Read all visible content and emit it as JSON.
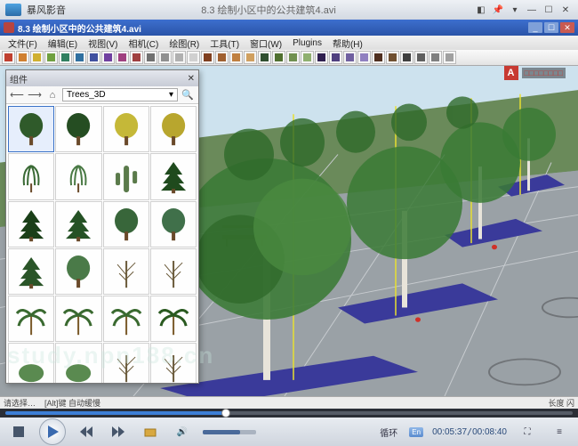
{
  "player": {
    "title": "暴风影音",
    "seek_percent": 38,
    "time_current": "00:05:37",
    "time_total": "00:08:40",
    "lang_badge": "En",
    "loop_label": "循环"
  },
  "app": {
    "title": "8.3 绘制小区中的公共建筑4.avi",
    "menu": {
      "file": "文件(F)",
      "edit": "编辑(E)",
      "view": "视图(V)",
      "camera": "相机(C)",
      "draw": "绘图(R)",
      "tools": "工具(T)",
      "window": "窗口(W)",
      "plugins": "Plugins",
      "help": "帮助(H)"
    },
    "status": {
      "left": "请选择…",
      "hint": "[Alt]键  自动缓慢",
      "right": "长度 闪"
    }
  },
  "panel": {
    "title": "组件",
    "collection": "Trees_3D"
  },
  "watermark": {
    "badge": "A",
    "text": "study.npn188.cn"
  },
  "thumbs": [
    {
      "shape": "broad",
      "fill": "#2f5a2a"
    },
    {
      "shape": "broad",
      "fill": "#254d22"
    },
    {
      "shape": "broad",
      "fill": "#c5b838"
    },
    {
      "shape": "broad",
      "fill": "#b8a62e"
    },
    {
      "shape": "weep",
      "fill": "#3a6a35"
    },
    {
      "shape": "weep",
      "fill": "#4a7a45"
    },
    {
      "shape": "cactus",
      "fill": "#5a7a4a"
    },
    {
      "shape": "pine",
      "fill": "#1f4a1d"
    },
    {
      "shape": "pine",
      "fill": "#1a3f18"
    },
    {
      "shape": "pine",
      "fill": "#255225"
    },
    {
      "shape": "broad",
      "fill": "#38663a"
    },
    {
      "shape": "broad",
      "fill": "#40704a"
    },
    {
      "shape": "pine",
      "fill": "#2a5528"
    },
    {
      "shape": "broad",
      "fill": "#4a7a48"
    },
    {
      "shape": "bare",
      "fill": "#6a5a3a"
    },
    {
      "shape": "bare",
      "fill": "#6a5a3a"
    },
    {
      "shape": "palm",
      "fill": "#3a6a30"
    },
    {
      "shape": "palm",
      "fill": "#3a6a30"
    },
    {
      "shape": "palm",
      "fill": "#3a6a30"
    },
    {
      "shape": "palm",
      "fill": "#2a5a20"
    },
    {
      "shape": "shrub",
      "fill": "#5a8a50"
    },
    {
      "shape": "shrub",
      "fill": "#5a8a50"
    },
    {
      "shape": "bare",
      "fill": "#6a5a3a"
    },
    {
      "shape": "bare",
      "fill": "#6a5a3a"
    },
    {
      "shape": "column",
      "fill": "#1f4a1d"
    },
    {
      "shape": "column",
      "fill": "#1f4a1d"
    },
    {
      "shape": "round",
      "fill": "#2a7a2a"
    },
    {
      "shape": "round",
      "fill": "#2a7a2a"
    }
  ],
  "toolbar_colors": [
    "#c04030",
    "#d08030",
    "#d0b030",
    "#70a040",
    "#308060",
    "#3070a0",
    "#4050a0",
    "#7040a0",
    "#a04080",
    "#a04040",
    "#707070",
    "#909090",
    "#b0b0b0",
    "#d0d0d0",
    "#804020",
    "#a06030",
    "#c08040",
    "#d0a060",
    "#305030",
    "#507030",
    "#709050",
    "#90b070",
    "#302050",
    "#504080",
    "#7060a0",
    "#9080c0",
    "#503020",
    "#705030",
    "#404040",
    "#606060",
    "#808080",
    "#a0a0a0"
  ]
}
